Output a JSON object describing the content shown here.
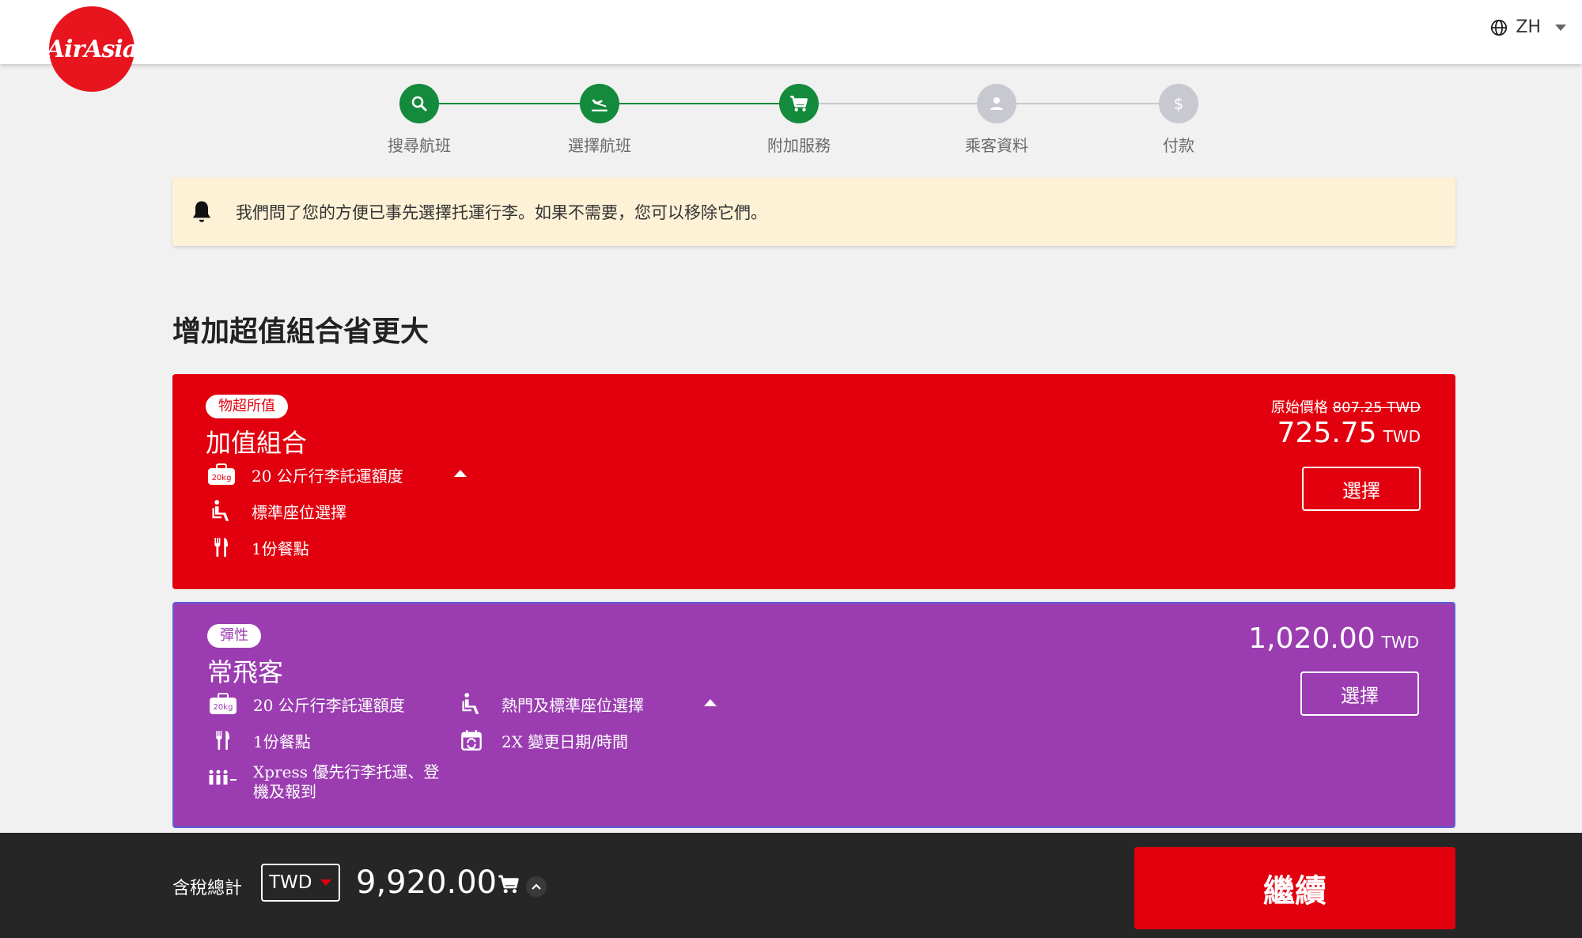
{
  "header": {
    "logo_text": "AirAsia",
    "language": "ZH"
  },
  "steps": [
    {
      "label": "搜尋航班",
      "state": "done",
      "icon": "search-icon"
    },
    {
      "label": "選擇航班",
      "state": "done",
      "icon": "plane-landing-icon"
    },
    {
      "label": "附加服務",
      "state": "done",
      "icon": "cart-icon"
    },
    {
      "label": "乘客資料",
      "state": "todo",
      "icon": "person-icon"
    },
    {
      "label": "付款",
      "state": "todo",
      "icon": "dollar-icon"
    }
  ],
  "notice": {
    "text": "我們問了您的方便已事先選擇托運行李。如果不需要，您可以移除它們。",
    "icon": "bell-icon"
  },
  "section_title": "增加超值組合省更大",
  "bundles": [
    {
      "tag": "物超所值",
      "title": "加值組合",
      "original_label": "原始價格",
      "original_price": "807.25 TWD",
      "price": "725.75",
      "currency": "TWD",
      "select_label": "選擇",
      "features": [
        {
          "icon": "luggage-20kg-icon",
          "text": "20 公斤行李託運額度"
        },
        {
          "icon": "seat-icon",
          "text": "標準座位選擇"
        },
        {
          "icon": "meal-icon",
          "text": "1份餐點"
        }
      ],
      "color": "#e2000f"
    },
    {
      "tag": "彈性",
      "title": "常飛客",
      "price": "1,020.00",
      "currency": "TWD",
      "select_label": "選擇",
      "features": [
        {
          "icon": "luggage-20kg-icon",
          "text": "20 公斤行李託運額度"
        },
        {
          "icon": "meal-icon",
          "text": "1份餐點"
        },
        {
          "icon": "xpress-icon",
          "text": "Xpress 優先行李托運、登機及報到"
        },
        {
          "icon": "seat-icon",
          "text": "熱門及標準座位選擇"
        },
        {
          "icon": "calendar-change-icon",
          "text": "2X 變更日期/時間"
        }
      ],
      "color": "#9b3db1"
    }
  ],
  "footer": {
    "total_label": "含稅總計",
    "currency": "TWD",
    "total": "9,920.00",
    "continue_label": "繼續"
  }
}
